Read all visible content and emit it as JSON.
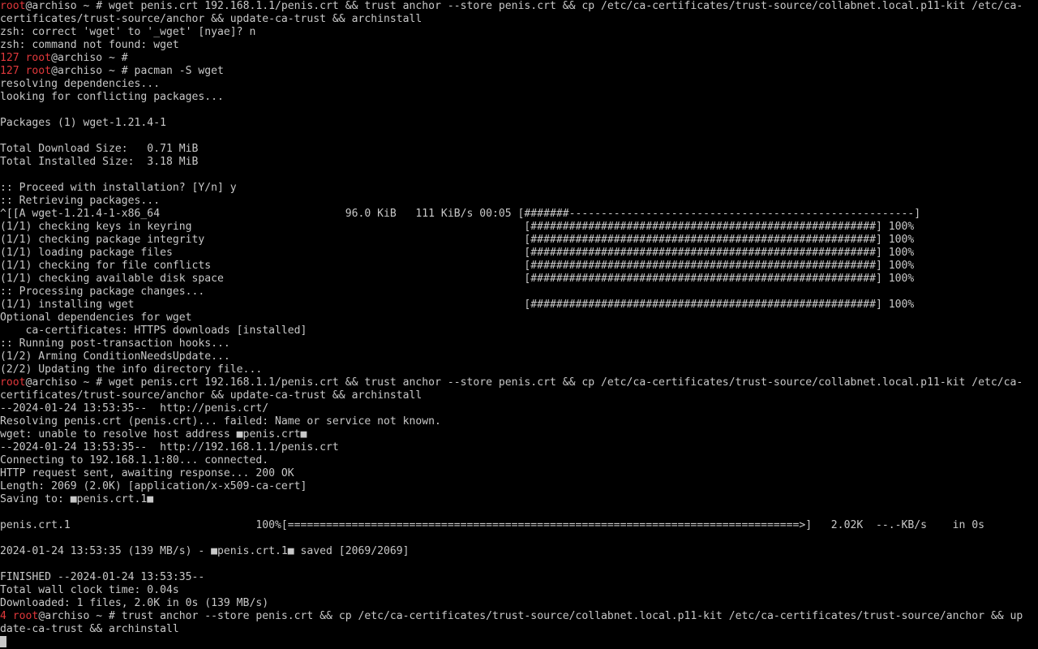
{
  "colors": {
    "background": "#000000",
    "text": "#c8c8c8",
    "prompt_red": "#e0383b"
  },
  "lines": [
    [
      {
        "t": "root",
        "c": "red"
      },
      {
        "t": "@archiso ~ # wget penis.crt 192.168.1.1/penis.crt && trust anchor --store penis.crt && cp /etc/ca-certificates/trust-source/collabnet.local.p11-kit /etc/ca-"
      }
    ],
    [
      {
        "t": "certificates/trust-source/anchor && update-ca-trust && archinstall"
      }
    ],
    [
      {
        "t": "zsh: correct 'wget' to '_wget' [nyae]? n"
      }
    ],
    [
      {
        "t": "zsh: command not found: wget"
      }
    ],
    [
      {
        "t": "127 root",
        "c": "red"
      },
      {
        "t": "@archiso ~ #"
      }
    ],
    [
      {
        "t": "127 root",
        "c": "red"
      },
      {
        "t": "@archiso ~ # pacman -S wget"
      }
    ],
    [
      {
        "t": "resolving dependencies..."
      }
    ],
    [
      {
        "t": "looking for conflicting packages..."
      }
    ],
    [
      {
        "t": ""
      }
    ],
    [
      {
        "t": "Packages (1) wget-1.21.4-1"
      }
    ],
    [
      {
        "t": ""
      }
    ],
    [
      {
        "t": "Total Download Size:   0.71 MiB"
      }
    ],
    [
      {
        "t": "Total Installed Size:  3.18 MiB"
      }
    ],
    [
      {
        "t": ""
      }
    ],
    [
      {
        "t": ":: Proceed with installation? [Y/n] y"
      }
    ],
    [
      {
        "t": ":: Retrieving packages..."
      }
    ],
    [
      {
        "t": "^[[A wget-1.21.4-1-x86_64                             96.0 KiB   111 KiB/s 00:05 [#######------------------------------------------------------]"
      }
    ],
    [
      {
        "t": "(1/1) checking keys in keyring                                                    [######################################################] 100%"
      }
    ],
    [
      {
        "t": "(1/1) checking package integrity                                                  [######################################################] 100%"
      }
    ],
    [
      {
        "t": "(1/1) loading package files                                                       [######################################################] 100%"
      }
    ],
    [
      {
        "t": "(1/1) checking for file conflicts                                                 [######################################################] 100%"
      }
    ],
    [
      {
        "t": "(1/1) checking available disk space                                               [######################################################] 100%"
      }
    ],
    [
      {
        "t": ":: Processing package changes..."
      }
    ],
    [
      {
        "t": "(1/1) installing wget                                                             [######################################################] 100%"
      }
    ],
    [
      {
        "t": "Optional dependencies for wget"
      }
    ],
    [
      {
        "t": "    ca-certificates: HTTPS downloads [installed]"
      }
    ],
    [
      {
        "t": ":: Running post-transaction hooks..."
      }
    ],
    [
      {
        "t": "(1/2) Arming ConditionNeedsUpdate..."
      }
    ],
    [
      {
        "t": "(2/2) Updating the info directory file..."
      }
    ],
    [
      {
        "t": "root",
        "c": "red"
      },
      {
        "t": "@archiso ~ # wget penis.crt 192.168.1.1/penis.crt && trust anchor --store penis.crt && cp /etc/ca-certificates/trust-source/collabnet.local.p11-kit /etc/ca-"
      }
    ],
    [
      {
        "t": "certificates/trust-source/anchor && update-ca-trust && archinstall"
      }
    ],
    [
      {
        "t": "--2024-01-24 13:53:35--  http://penis.crt/"
      }
    ],
    [
      {
        "t": "Resolving penis.crt (penis.crt)... failed: Name or service not known."
      }
    ],
    [
      {
        "t": "wget: unable to resolve host address ■penis.crt■"
      }
    ],
    [
      {
        "t": "--2024-01-24 13:53:35--  http://192.168.1.1/penis.crt"
      }
    ],
    [
      {
        "t": "Connecting to 192.168.1.1:80... connected."
      }
    ],
    [
      {
        "t": "HTTP request sent, awaiting response... 200 OK"
      }
    ],
    [
      {
        "t": "Length: 2069 (2.0K) [application/x-x509-ca-cert]"
      }
    ],
    [
      {
        "t": "Saving to: ■penis.crt.1■"
      }
    ],
    [
      {
        "t": ""
      }
    ],
    [
      {
        "t": "penis.crt.1                             100%[================================================================================>]   2.02K  --.-KB/s    in 0s"
      }
    ],
    [
      {
        "t": ""
      }
    ],
    [
      {
        "t": "2024-01-24 13:53:35 (139 MB/s) - ■penis.crt.1■ saved [2069/2069]"
      }
    ],
    [
      {
        "t": ""
      }
    ],
    [
      {
        "t": "FINISHED --2024-01-24 13:53:35--"
      }
    ],
    [
      {
        "t": "Total wall clock time: 0.04s"
      }
    ],
    [
      {
        "t": "Downloaded: 1 files, 2.0K in 0s (139 MB/s)"
      }
    ],
    [
      {
        "t": "4 root",
        "c": "red"
      },
      {
        "t": "@archiso ~ # trust anchor --store penis.crt && cp /etc/ca-certificates/trust-source/collabnet.local.p11-kit /etc/ca-certificates/trust-source/anchor && up"
      }
    ],
    [
      {
        "t": "date-ca-trust && archinstall"
      }
    ],
    [
      {
        "t": ""
      }
    ]
  ]
}
